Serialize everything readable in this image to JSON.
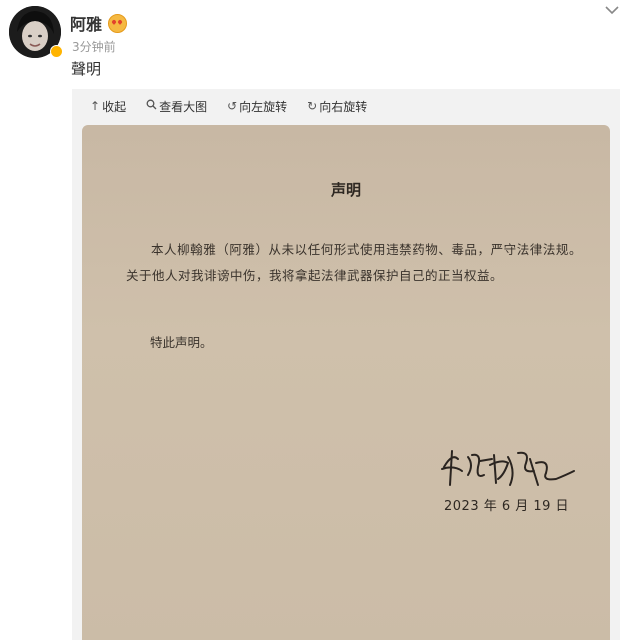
{
  "post": {
    "username": "阿雅",
    "time": "3分钟前",
    "text": "聲明"
  },
  "toolbar": {
    "collapse": "收起",
    "view_large": "查看大图",
    "rotate_left": "向左旋转",
    "rotate_right": "向右旋转"
  },
  "document": {
    "title": "声明",
    "body": "本人柳翰雅（阿雅）从未以任何形式使用违禁药物、毒品，严守法律法规。关于他人对我诽谤中伤，我将拿起法律武器保护自己的正当权益。",
    "closing": "特此声明。",
    "signature": "柳翰雅",
    "date": "2023 年 6 月 19 日"
  },
  "colors": {
    "paper": "#cbbca7",
    "viewer_bg": "#f2f2f2",
    "badge": "#ffb400"
  }
}
